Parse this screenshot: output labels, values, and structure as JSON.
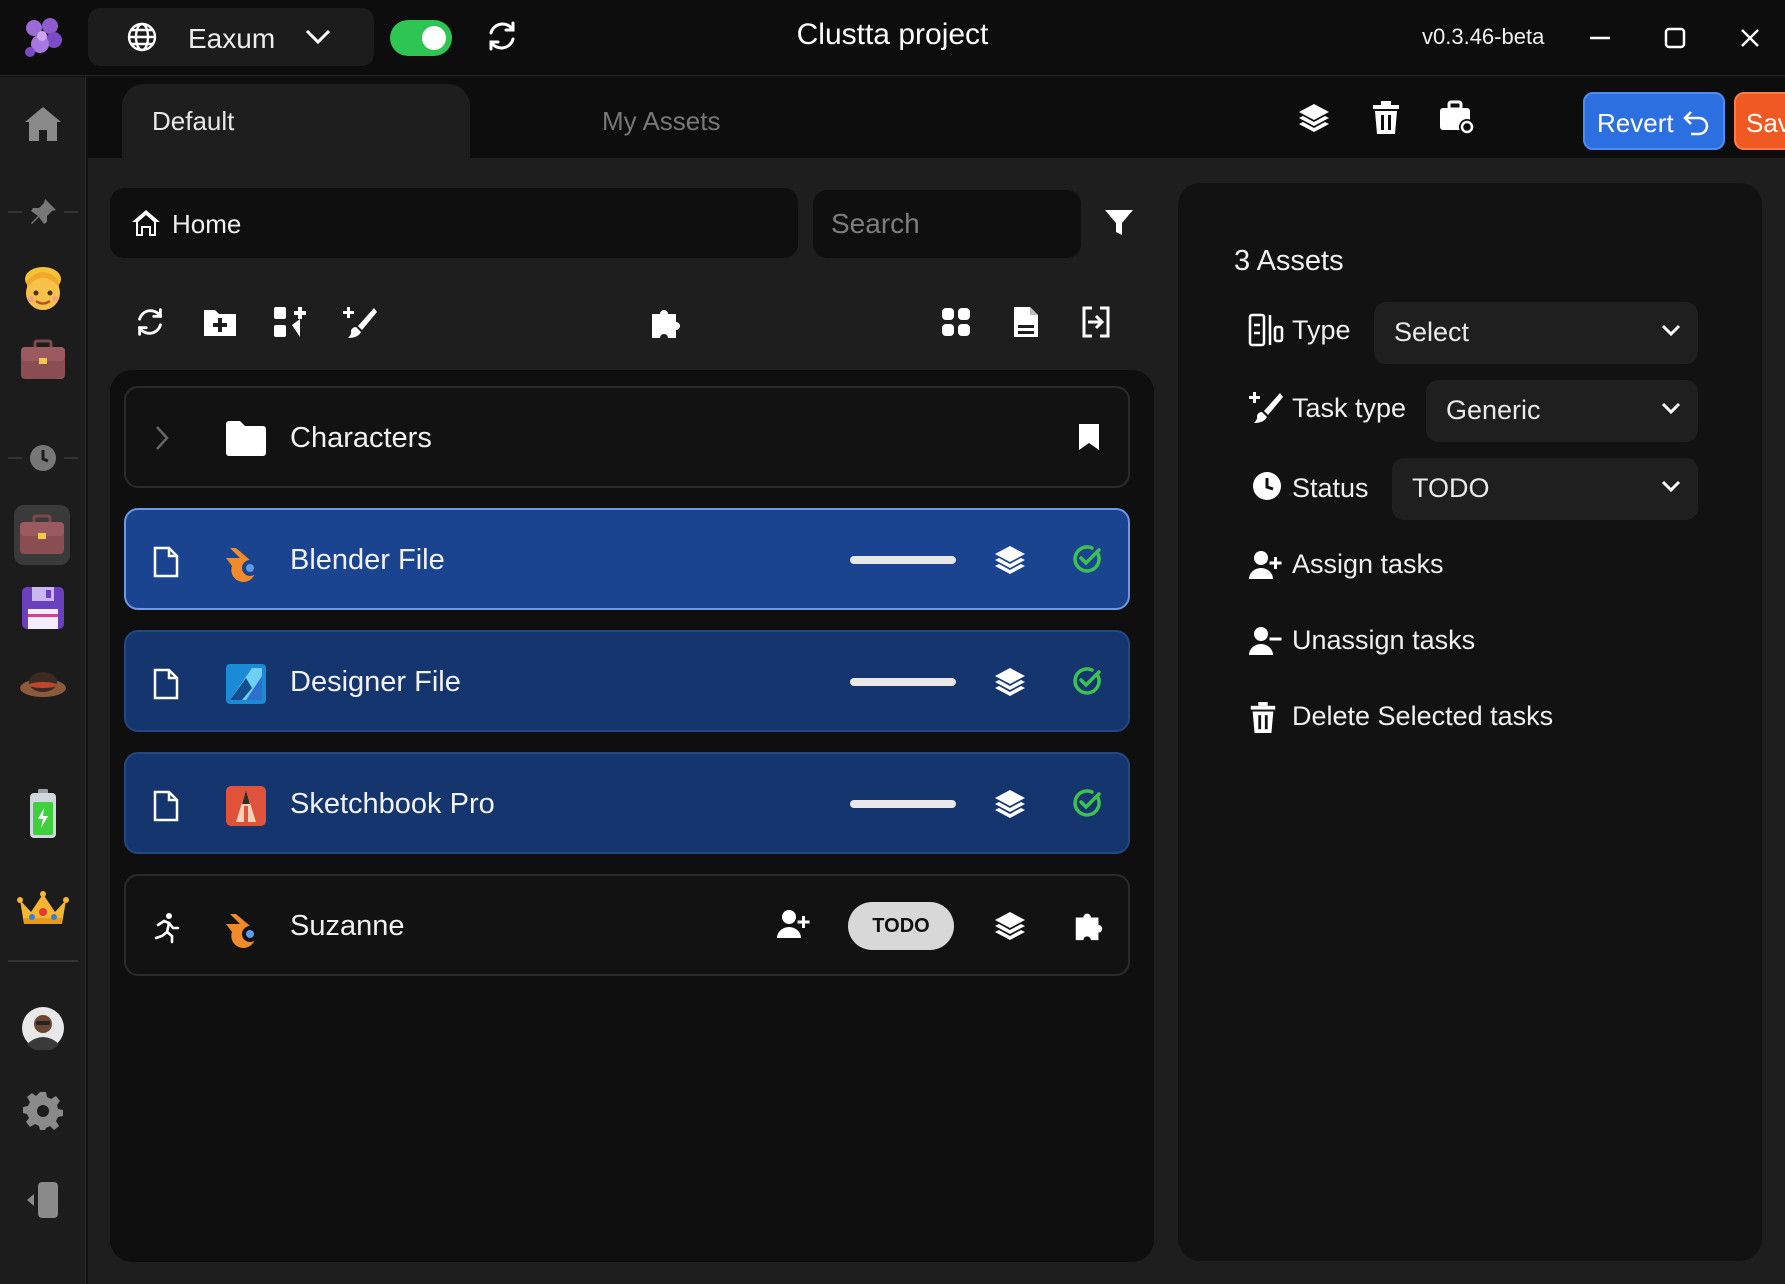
{
  "titlebar": {
    "workspace": "Eaxum",
    "sync_enabled": true,
    "title": "Clustta project",
    "version": "v0.3.46-beta"
  },
  "tabs": [
    {
      "label": "Default",
      "active": true
    },
    {
      "label": "My Assets",
      "active": false
    }
  ],
  "toolbar": {
    "revert_label": "Revert",
    "save_label": "Save",
    "revert_color": "#2c6fe0",
    "save_color": "#ef5a23"
  },
  "breadcrumb": {
    "label": "Home"
  },
  "search": {
    "placeholder": "Search"
  },
  "items": [
    {
      "type": "folder",
      "name": "Characters",
      "icon": "folder-icon"
    },
    {
      "type": "file",
      "name": "Blender File",
      "app": "blender-icon",
      "selected": true,
      "status": "done"
    },
    {
      "type": "file",
      "name": "Designer File",
      "app": "affinity-designer-icon",
      "selected": false,
      "status": "done"
    },
    {
      "type": "file",
      "name": "Sketchbook Pro",
      "app": "sketchbook-icon",
      "selected": false,
      "status": "done"
    },
    {
      "type": "task",
      "name": "Suzanne",
      "app": "blender-icon",
      "status_label": "TODO"
    }
  ],
  "panel": {
    "count": "3 Assets",
    "type_label": "Type",
    "type_value": "Select",
    "task_type_label": "Task type",
    "task_type_value": "Generic",
    "status_label": "Status",
    "status_value": "TODO",
    "assign_label": "Assign tasks",
    "unassign_label": "Unassign tasks",
    "delete_label": "Delete Selected tasks"
  }
}
